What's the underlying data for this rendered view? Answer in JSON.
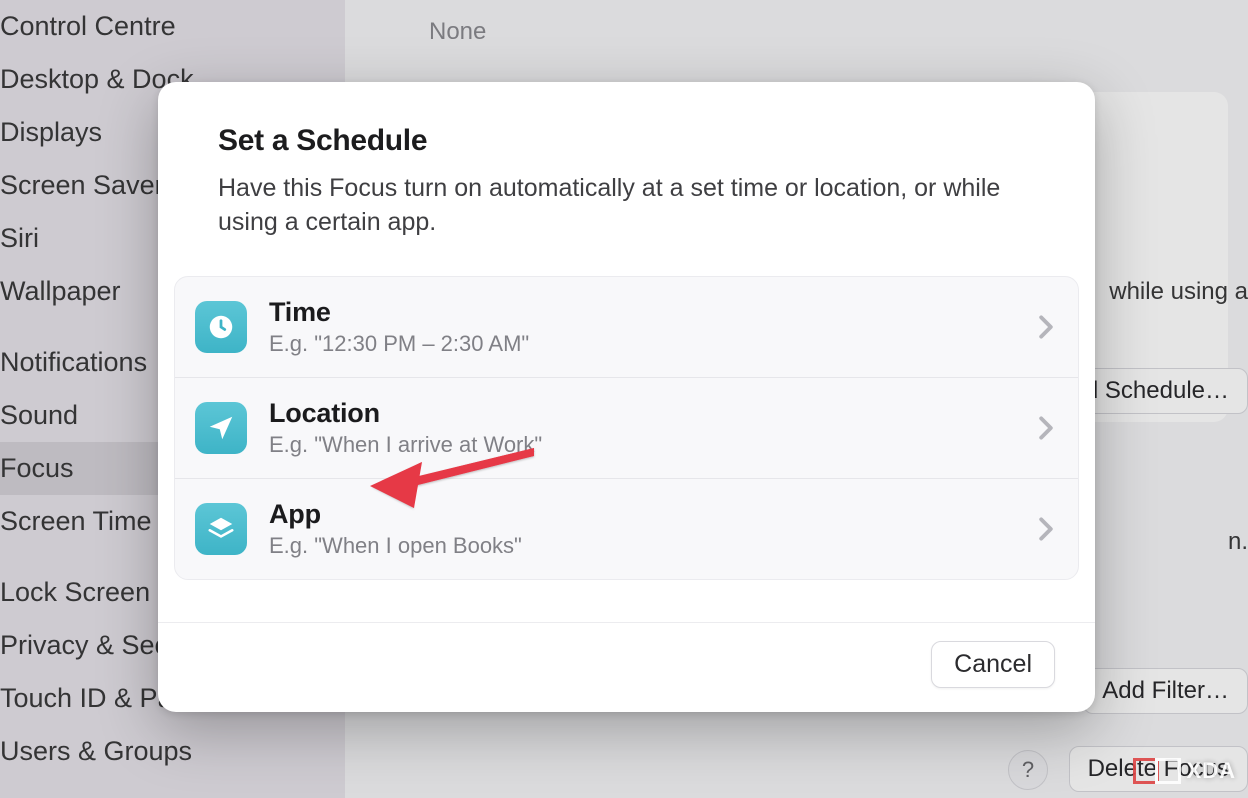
{
  "sidebar": {
    "items": [
      {
        "label": "Control Centre"
      },
      {
        "label": "Desktop & Dock"
      },
      {
        "label": "Displays"
      },
      {
        "label": "Screen Saver"
      },
      {
        "label": "Siri"
      },
      {
        "label": "Wallpaper"
      },
      {
        "label": "Notifications"
      },
      {
        "label": "Sound"
      },
      {
        "label": "Focus",
        "selected": true
      },
      {
        "label": "Screen Time"
      },
      {
        "label": "Lock Screen"
      },
      {
        "label": "Privacy & Security"
      },
      {
        "label": "Touch ID & Password"
      },
      {
        "label": "Users & Groups"
      }
    ]
  },
  "background": {
    "top_value": "None",
    "right_fragment_1": "while using a",
    "add_schedule_btn": "Add Schedule…",
    "right_fragment_2": "n.",
    "add_filter_btn": "Add Filter…",
    "delete_focus_btn": "Delete Focus",
    "help_symbol": "?"
  },
  "modal": {
    "title": "Set a Schedule",
    "description": "Have this Focus turn on automatically at a set time or location, or while using a certain app.",
    "options": [
      {
        "title": "Time",
        "subtitle": "E.g. \"12:30 PM – 2:30 AM\"",
        "icon": "clock-icon"
      },
      {
        "title": "Location",
        "subtitle": "E.g. \"When I arrive at Work\"",
        "icon": "location-arrow-icon"
      },
      {
        "title": "App",
        "subtitle": "E.g. \"When I open Books\"",
        "icon": "stack-icon"
      }
    ],
    "cancel": "Cancel"
  },
  "watermark": {
    "text": "XDA"
  }
}
